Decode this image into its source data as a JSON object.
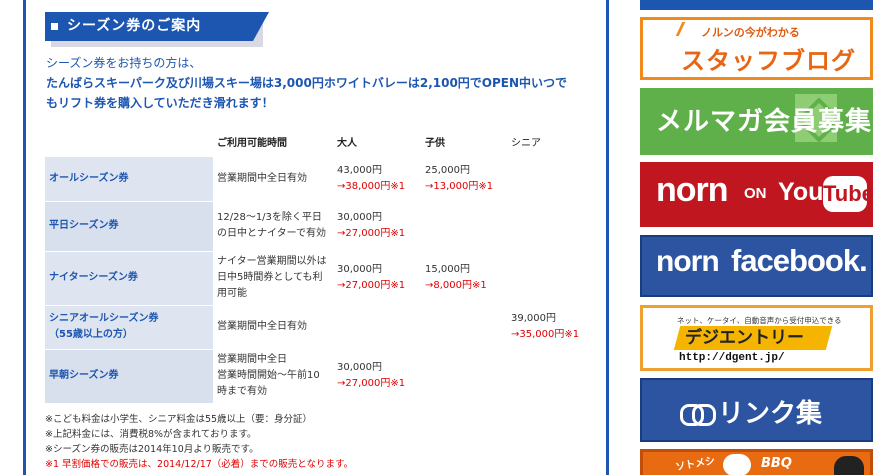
{
  "section": {
    "heading": "シーズン券のご案内",
    "intro_line1": "シーズン券をお持ちの方は、",
    "intro_line2": "たんばらスキーパーク及び川場スキー場は3,000円ホワイトバレーは2,100円でOPEN中いつで",
    "intro_line3": "もリフト券を購入していただき滑れます！"
  },
  "table": {
    "headers": {
      "name": "",
      "hours": "ご利用可能時間",
      "adult": "大人",
      "child": "子供",
      "senior": "シニア"
    },
    "rows": [
      {
        "name": "オールシーズン券",
        "hours": "営業期間中全日有効",
        "adult_price": "43,000円",
        "adult_early": "→38,000円※1",
        "child_price": "25,000円",
        "child_early": "→13,000円※1",
        "senior_price": "",
        "senior_early": ""
      },
      {
        "name": "平日シーズン券",
        "hours": "12/28～1/3を除く平日の日中とナイターで有効",
        "adult_price": "30,000円",
        "adult_early": "→27,000円※1",
        "child_price": "",
        "child_early": "",
        "senior_price": "",
        "senior_early": ""
      },
      {
        "name": "ナイターシーズン券",
        "hours": "ナイター営業期間以外は日中5時間券としても利用可能",
        "adult_price": "30,000円",
        "adult_early": "→27,000円※1",
        "child_price": "15,000円",
        "child_early": "→8,000円※1",
        "senior_price": "",
        "senior_early": ""
      },
      {
        "name": "シニアオールシーズン券",
        "name_sub": "（55歳以上の方）",
        "hours": "営業期間中全日有効",
        "adult_price": "",
        "adult_early": "",
        "child_price": "",
        "child_early": "",
        "senior_price": "39,000円",
        "senior_early": "→35,000円※1"
      },
      {
        "name": "早朝シーズン券",
        "hours_line1": "営業期間中全日",
        "hours_line2": "営業時間開始～午前10時まで有効",
        "adult_price": "30,000円",
        "adult_early": "→27,000円※1",
        "child_price": "",
        "child_early": "",
        "senior_price": "",
        "senior_early": ""
      }
    ]
  },
  "notes": [
    "※こども料金は小学生、シニア料金は55歳以上（要：身分証）",
    "※上記料金には、消費税8%が含まれております。",
    "※シーズン券の販売は2014年10月より販売です。",
    "※1 早割価格での販売は、2014/12/17（必着）までの販売となります。"
  ],
  "sidebar": {
    "blog_sub": "ノルンの今がわかる",
    "blog_main": "スタッフブログ",
    "mailmag": "メルマガ会員募集",
    "yt_norn": "norn",
    "yt_on": "ON",
    "yt_you": "You",
    "yt_tube": "Tube",
    "fb_norn": "norn",
    "fb_facebook": "facebook.",
    "dg_sub": "ネット、ケータイ、自動音声から受付申込できる",
    "dg_logo": "デジエントリー",
    "dg_url": "http://dgent.jp/",
    "link": "リンク集",
    "bbq_t1": "BBQ",
    "bbq_t2": "ソトメシ"
  },
  "colors": {
    "accent_blue": "#1d56b0",
    "table_name_bg": "#d8e0ee",
    "early_red": "#e00000"
  }
}
